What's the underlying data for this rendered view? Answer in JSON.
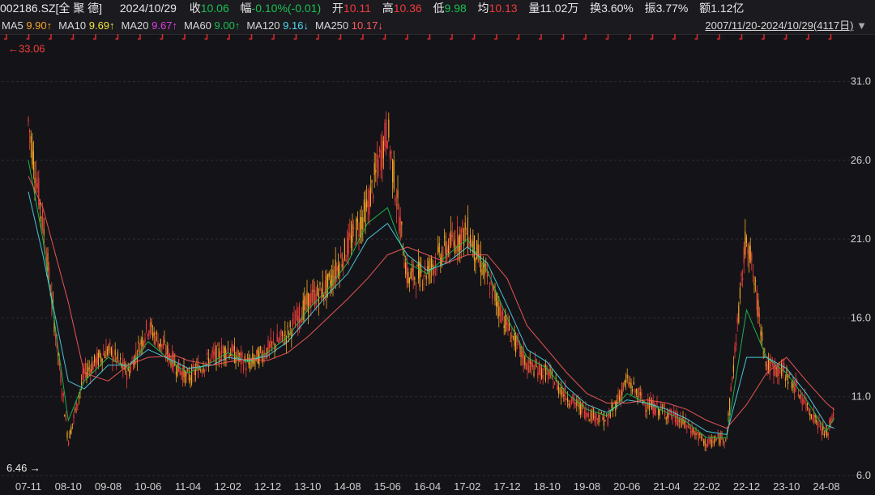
{
  "quote": {
    "code": "002186.SZ",
    "name": "[全 聚 德]",
    "date": "2024/10/29",
    "close_label": "收",
    "close": "10.06",
    "change_label": "幅",
    "change": "-0.10%(-0.01)",
    "open_label": "开",
    "open": "10.11",
    "high_label": "高",
    "high": "10.36",
    "low_label": "低",
    "low": "9.98",
    "avg_label": "均",
    "avg": "10.13",
    "vol_label": "量",
    "vol": "11.02万",
    "turnover_label": "换",
    "turnover": "3.60%",
    "amplitude_label": "振",
    "amplitude": "3.77%",
    "amount_label": "额",
    "amount": "1.12亿"
  },
  "ma_bar": {
    "items": [
      {
        "label": "MA5",
        "value": "9.90",
        "arrow": "↑",
        "color": "#f5a623"
      },
      {
        "label": "MA10",
        "value": "9.69",
        "arrow": "↑",
        "color": "#f2e33a"
      },
      {
        "label": "MA20",
        "value": "9.67",
        "arrow": "↑",
        "color": "#e23ee2"
      },
      {
        "label": "MA60",
        "value": "9.00",
        "arrow": "↑",
        "color": "#19c152"
      },
      {
        "label": "MA120",
        "value": "9.16",
        "arrow": "↓",
        "color": "#4fd6ea"
      },
      {
        "label": "MA250",
        "value": "10.17",
        "arrow": "↓",
        "color": "#ff5a5a"
      }
    ],
    "range": "2007/11/20-2024/10/29(4117日)",
    "range_arrow": "▼"
  },
  "chart_data": {
    "type": "line",
    "title": "",
    "xlabel": "",
    "ylabel": "",
    "ylim": [
      6.0,
      33.5
    ],
    "y_ticks": [
      "31.0",
      "26.0",
      "21.0",
      "16.0",
      "11.0",
      "6.0"
    ],
    "x_ticks": [
      "07-11",
      "08-10",
      "09-08",
      "10-06",
      "11-04",
      "12-02",
      "12-12",
      "13-10",
      "14-08",
      "15-06",
      "16-04",
      "17-02",
      "17-12",
      "18-10",
      "19-08",
      "20-06",
      "21-04",
      "22-02",
      "22-12",
      "23-10",
      "24-08"
    ],
    "max_label": "33.06",
    "min_label": "6.46",
    "colors": {
      "up": "#f03c3c",
      "down": "#f5a623",
      "ma20": "#19c152",
      "ma60": "#4fd6ea",
      "ma250": "#ff5a5a",
      "grid": "#2c2c33"
    },
    "series": [
      {
        "name": "MA5",
        "x": [
          "07-11",
          "08-03",
          "08-10",
          "09-02",
          "09-08",
          "10-01",
          "10-06",
          "11-01",
          "11-04",
          "11-10",
          "12-02",
          "12-07",
          "12-12",
          "13-05",
          "13-10",
          "14-03",
          "14-08",
          "15-01",
          "15-06",
          "15-11",
          "16-04",
          "16-09",
          "17-02",
          "17-07",
          "17-12",
          "18-05",
          "18-10",
          "19-03",
          "19-08",
          "20-01",
          "20-06",
          "20-11",
          "21-04",
          "21-09",
          "22-02",
          "22-07",
          "22-12",
          "23-05",
          "23-10",
          "24-03",
          "24-08",
          "24-10"
        ],
        "values": [
          28.5,
          22.0,
          8.2,
          12.5,
          14.0,
          12.5,
          15.5,
          13.0,
          12.2,
          13.5,
          14.0,
          13.0,
          14.0,
          15.0,
          17.0,
          18.0,
          20.5,
          23.0,
          28.0,
          18.5,
          19.0,
          20.5,
          21.5,
          18.5,
          15.5,
          13.0,
          12.5,
          11.0,
          10.0,
          9.5,
          12.0,
          10.5,
          10.0,
          9.2,
          8.0,
          8.5,
          21.5,
          13.0,
          12.5,
          10.5,
          8.5,
          10.06
        ]
      },
      {
        "name": "MA20",
        "x": [
          "07-11",
          "08-03",
          "08-10",
          "09-02",
          "09-08",
          "10-01",
          "10-06",
          "11-01",
          "11-04",
          "11-10",
          "12-02",
          "12-07",
          "12-12",
          "13-05",
          "13-10",
          "14-03",
          "14-08",
          "15-01",
          "15-06",
          "15-11",
          "16-04",
          "16-09",
          "17-02",
          "17-07",
          "17-12",
          "18-05",
          "18-10",
          "19-03",
          "19-08",
          "20-01",
          "20-06",
          "20-11",
          "21-04",
          "21-09",
          "22-02",
          "22-07",
          "22-12",
          "23-05",
          "23-10",
          "24-03",
          "24-08",
          "24-10"
        ],
        "values": [
          26.0,
          21.0,
          9.5,
          12.0,
          13.5,
          12.8,
          14.5,
          13.0,
          12.5,
          13.2,
          13.8,
          13.2,
          13.8,
          14.8,
          16.5,
          17.8,
          19.5,
          22.0,
          23.0,
          19.5,
          18.8,
          20.0,
          21.0,
          19.0,
          16.0,
          13.5,
          12.8,
          11.2,
          10.2,
          9.8,
          11.2,
          10.6,
          10.0,
          9.4,
          8.4,
          8.4,
          16.5,
          13.5,
          12.5,
          10.8,
          8.8,
          9.67
        ]
      },
      {
        "name": "MA60",
        "x": [
          "07-11",
          "08-03",
          "08-10",
          "09-02",
          "09-08",
          "10-01",
          "10-06",
          "11-01",
          "11-04",
          "11-10",
          "12-02",
          "12-07",
          "12-12",
          "13-05",
          "13-10",
          "14-03",
          "14-08",
          "15-01",
          "15-06",
          "15-11",
          "16-04",
          "16-09",
          "17-02",
          "17-07",
          "17-12",
          "18-05",
          "18-10",
          "19-03",
          "19-08",
          "20-01",
          "20-06",
          "20-11",
          "21-04",
          "21-09",
          "22-02",
          "22-07",
          "22-12",
          "23-05",
          "23-10",
          "24-03",
          "24-08",
          "24-10"
        ],
        "values": [
          24.0,
          20.0,
          12.0,
          11.5,
          13.0,
          13.0,
          14.0,
          13.2,
          12.8,
          13.0,
          13.5,
          13.3,
          13.6,
          14.5,
          16.0,
          17.5,
          18.8,
          21.0,
          22.0,
          20.0,
          19.0,
          19.5,
          20.5,
          19.5,
          16.8,
          14.0,
          13.2,
          11.6,
          10.5,
          10.0,
          10.8,
          10.6,
          10.2,
          9.6,
          8.8,
          8.6,
          13.5,
          13.5,
          12.8,
          11.2,
          9.2,
          9.0
        ]
      },
      {
        "name": "MA250",
        "x": [
          "07-11",
          "08-03",
          "08-10",
          "09-02",
          "09-08",
          "10-01",
          "10-06",
          "11-01",
          "11-04",
          "11-10",
          "12-02",
          "12-07",
          "12-12",
          "13-05",
          "13-10",
          "14-03",
          "14-08",
          "15-01",
          "15-06",
          "15-11",
          "16-04",
          "16-09",
          "17-02",
          "17-07",
          "17-12",
          "18-05",
          "18-10",
          "19-03",
          "19-08",
          "20-01",
          "20-06",
          "20-11",
          "21-04",
          "21-09",
          "22-02",
          "22-07",
          "22-12",
          "23-05",
          "23-10",
          "24-03",
          "24-08",
          "24-10"
        ],
        "values": [
          25.0,
          23.0,
          17.0,
          12.5,
          12.0,
          13.0,
          13.5,
          13.6,
          13.3,
          13.0,
          13.2,
          13.4,
          13.3,
          13.8,
          14.8,
          16.0,
          17.2,
          18.5,
          20.0,
          20.5,
          20.0,
          19.5,
          20.0,
          20.0,
          18.5,
          15.5,
          14.0,
          12.5,
          11.2,
          10.6,
          10.6,
          10.8,
          10.6,
          10.2,
          9.5,
          9.0,
          10.5,
          12.5,
          13.5,
          12.0,
          10.6,
          10.17
        ]
      }
    ]
  }
}
